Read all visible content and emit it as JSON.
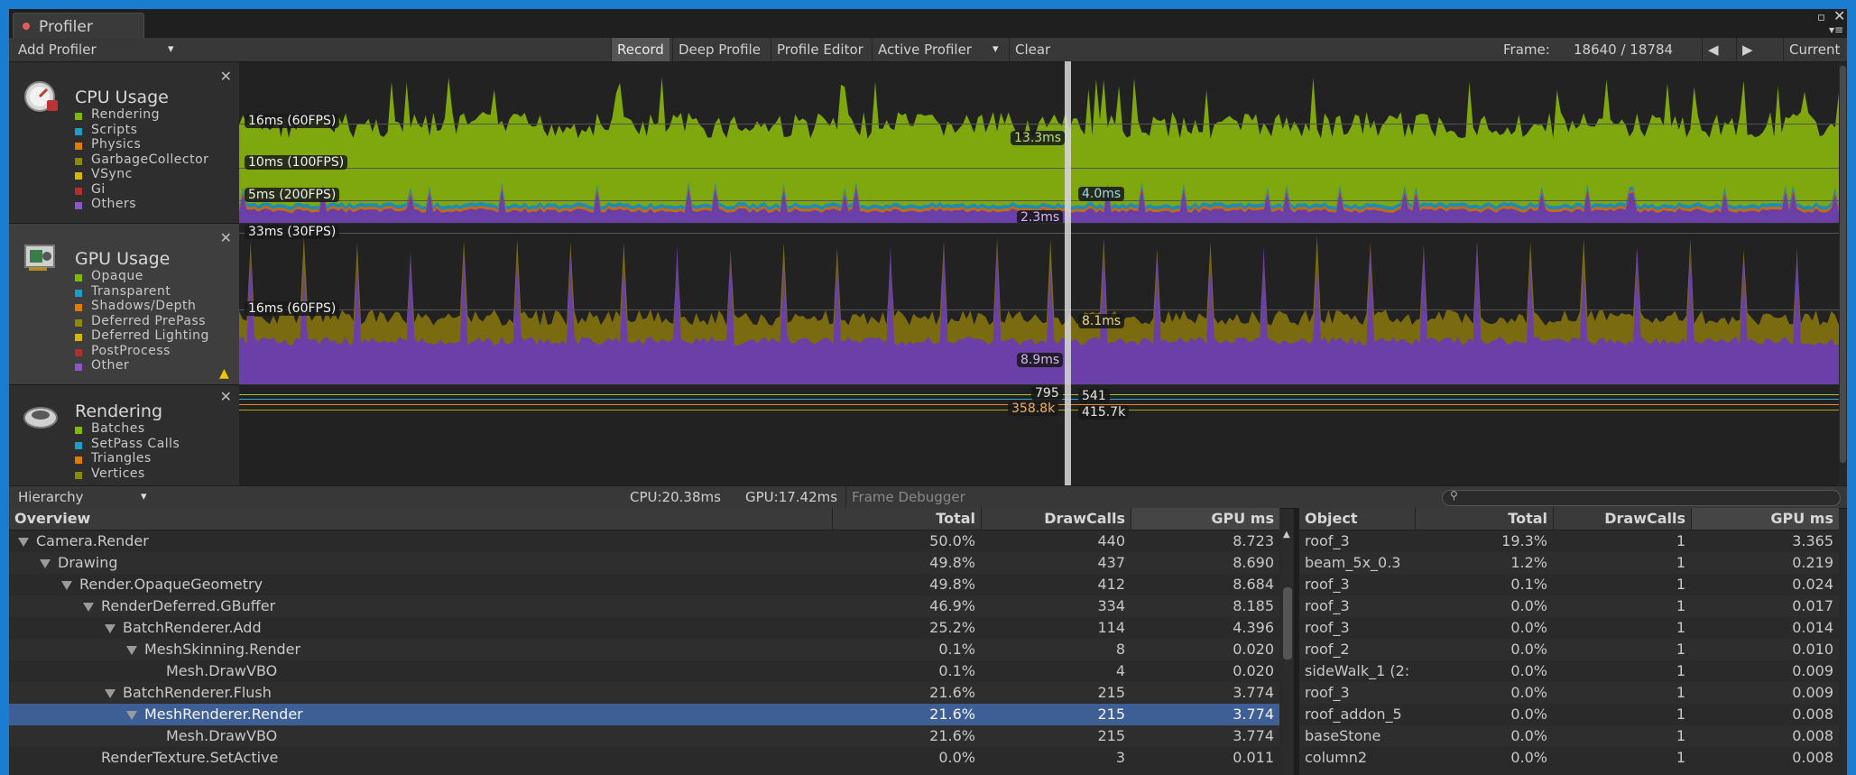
{
  "window": {
    "tab_title": "Profiler"
  },
  "toolbar": {
    "add_profiler": "Add Profiler",
    "record": "Record",
    "deep_profile": "Deep Profile",
    "profile_editor": "Profile Editor",
    "active_profiler": "Active Profiler",
    "clear": "Clear",
    "frame_label": "Frame:",
    "frame_value": "18640 / 18784",
    "current": "Current"
  },
  "cpu": {
    "title": "CPU Usage",
    "legend": [
      {
        "label": "Rendering",
        "color": "#7fb800"
      },
      {
        "label": "Scripts",
        "color": "#1f9bc8"
      },
      {
        "label": "Physics",
        "color": "#e07b00"
      },
      {
        "label": "GarbageCollector",
        "color": "#8a8a00"
      },
      {
        "label": "VSync",
        "color": "#d8b600"
      },
      {
        "label": "Gi",
        "color": "#b22d2d"
      },
      {
        "label": "Others",
        "color": "#8a56c8"
      }
    ],
    "labels": {
      "l16": "16ms (60FPS)",
      "l10": "10ms (100FPS)",
      "l5": "5ms (200FPS)"
    },
    "values": {
      "rendering": "13.3ms",
      "scripts": "4.0ms",
      "others": "2.3ms"
    }
  },
  "gpu": {
    "title": "GPU Usage",
    "legend": [
      {
        "label": "Opaque",
        "color": "#7fb800"
      },
      {
        "label": "Transparent",
        "color": "#1f9bc8"
      },
      {
        "label": "Shadows/Depth",
        "color": "#e07b00"
      },
      {
        "label": "Deferred PrePass",
        "color": "#8a8a00"
      },
      {
        "label": "Deferred Lighting",
        "color": "#d8b600"
      },
      {
        "label": "PostProcess",
        "color": "#b22d2d"
      },
      {
        "label": "Other",
        "color": "#8a56c8"
      }
    ],
    "labels": {
      "l33": "33ms (30FPS)",
      "l16": "16ms (60FPS)"
    },
    "values": {
      "opaque": "8.1ms",
      "other": "8.9ms"
    }
  },
  "rendering": {
    "title": "Rendering",
    "legend": [
      {
        "label": "Batches",
        "color": "#7fb800"
      },
      {
        "label": "SetPass Calls",
        "color": "#1f9bc8"
      },
      {
        "label": "Triangles",
        "color": "#e07b00"
      },
      {
        "label": "Vertices",
        "color": "#8a8a00"
      }
    ],
    "values": {
      "batches": "795",
      "setpass": "541",
      "triangles": "358.8k",
      "vertices": "415.7k"
    }
  },
  "bottombar": {
    "hierarchy": "Hierarchy",
    "cpu": "CPU:20.38ms",
    "gpu": "GPU:17.42ms",
    "frame_debugger": "Frame Debugger"
  },
  "left_table": {
    "headers": [
      "Overview",
      "Total",
      "DrawCalls",
      "GPU ms"
    ],
    "rows": [
      {
        "name": "Camera.Render",
        "total": "50.0%",
        "draw": "440",
        "gpu": "8.723"
      },
      {
        "name": "Drawing",
        "total": "49.8%",
        "draw": "437",
        "gpu": "8.690"
      },
      {
        "name": "Render.OpaqueGeometry",
        "total": "49.8%",
        "draw": "412",
        "gpu": "8.684"
      },
      {
        "name": "RenderDeferred.GBuffer",
        "total": "46.9%",
        "draw": "334",
        "gpu": "8.185"
      },
      {
        "name": "BatchRenderer.Add",
        "total": "25.2%",
        "draw": "114",
        "gpu": "4.396"
      },
      {
        "name": "MeshSkinning.Render",
        "total": "0.1%",
        "draw": "8",
        "gpu": "0.020"
      },
      {
        "name": "Mesh.DrawVBO",
        "total": "0.1%",
        "draw": "4",
        "gpu": "0.020"
      },
      {
        "name": "BatchRenderer.Flush",
        "total": "21.6%",
        "draw": "215",
        "gpu": "3.774"
      },
      {
        "name": "MeshRenderer.Render",
        "total": "21.6%",
        "draw": "215",
        "gpu": "3.774"
      },
      {
        "name": "Mesh.DrawVBO",
        "total": "21.6%",
        "draw": "215",
        "gpu": "3.774"
      },
      {
        "name": "RenderTexture.SetActive",
        "total": "0.0%",
        "draw": "3",
        "gpu": "0.011"
      }
    ]
  },
  "right_table": {
    "headers": [
      "Object",
      "Total",
      "DrawCalls",
      "GPU ms"
    ],
    "rows": [
      {
        "name": "roof_3",
        "total": "19.3%",
        "draw": "1",
        "gpu": "3.365"
      },
      {
        "name": "beam_5x_0.3",
        "total": "1.2%",
        "draw": "1",
        "gpu": "0.219"
      },
      {
        "name": "roof_3",
        "total": "0.1%",
        "draw": "1",
        "gpu": "0.024"
      },
      {
        "name": "roof_3",
        "total": "0.0%",
        "draw": "1",
        "gpu": "0.017"
      },
      {
        "name": "roof_3",
        "total": "0.0%",
        "draw": "1",
        "gpu": "0.014"
      },
      {
        "name": "roof_2",
        "total": "0.0%",
        "draw": "1",
        "gpu": "0.010"
      },
      {
        "name": "sideWalk_1 (2:",
        "total": "0.0%",
        "draw": "1",
        "gpu": "0.009"
      },
      {
        "name": "roof_3",
        "total": "0.0%",
        "draw": "1",
        "gpu": "0.009"
      },
      {
        "name": "roof_addon_5",
        "total": "0.0%",
        "draw": "1",
        "gpu": "0.008"
      },
      {
        "name": "baseStone",
        "total": "0.0%",
        "draw": "1",
        "gpu": "0.008"
      },
      {
        "name": "column2",
        "total": "0.0%",
        "draw": "1",
        "gpu": "0.008"
      }
    ]
  }
}
